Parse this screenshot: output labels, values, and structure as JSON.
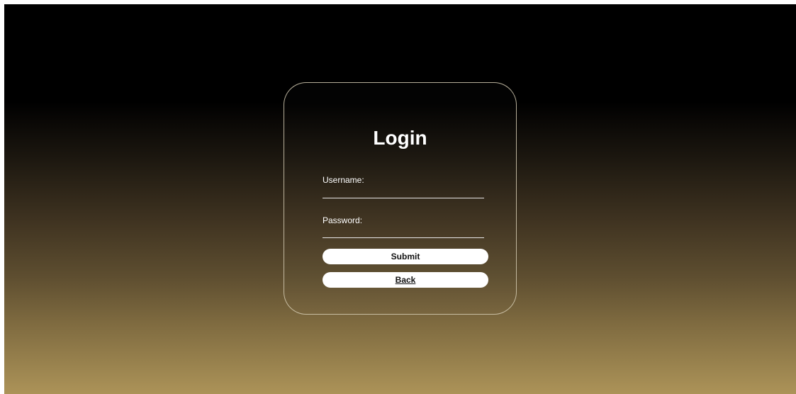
{
  "login": {
    "title": "Login",
    "username_label": "Username:",
    "username_value": "",
    "password_label": "Password:",
    "password_value": "",
    "submit_label": "Submit",
    "back_label": "Back"
  },
  "colors": {
    "background_top": "#000000",
    "background_bottom": "#ac9358",
    "card_border": "#d6cdb4",
    "button_background": "#ffffff",
    "text": "#ffffff"
  }
}
